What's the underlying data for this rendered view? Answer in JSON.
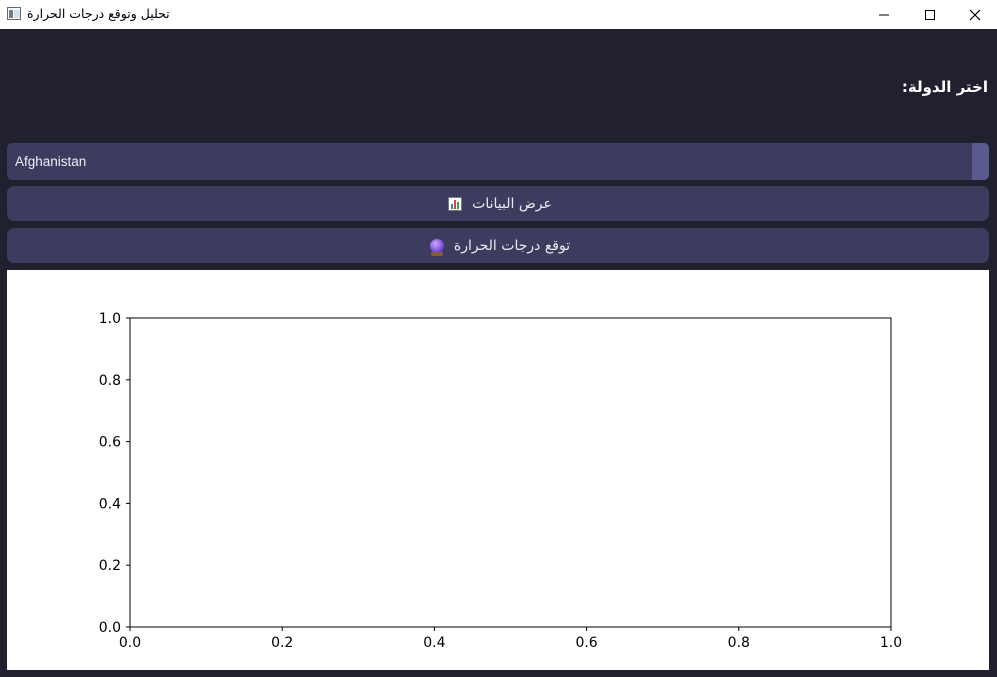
{
  "window": {
    "title": "تحليل وتوقع درجات الحرارة",
    "icons": {
      "app": "app-window-icon",
      "minimize": "minimize-icon",
      "maximize": "maximize-icon",
      "close": "close-icon"
    }
  },
  "controls": {
    "country_label": "اختر الدولة:",
    "country_selected": "Afghanistan",
    "show_data_label": "عرض البيانات",
    "show_data_icon": "bar-chart-emoji-icon",
    "predict_label": "توقع درجات الحرارة",
    "predict_icon": "crystal-ball-emoji-icon"
  },
  "colors": {
    "background": "#20202e",
    "control": "#3c3c5e",
    "combo_arrow": "#5a5a8e",
    "text": "#ffffff"
  },
  "chart_data": {
    "type": "line",
    "series": [],
    "xlim": [
      0.0,
      1.0
    ],
    "ylim": [
      0.0,
      1.0
    ],
    "xticks": [
      "0.0",
      "0.2",
      "0.4",
      "0.6",
      "0.8",
      "1.0"
    ],
    "yticks": [
      "0.0",
      "0.2",
      "0.4",
      "0.6",
      "0.8",
      "1.0"
    ],
    "title": "",
    "xlabel": "",
    "ylabel": "",
    "grid": false
  }
}
